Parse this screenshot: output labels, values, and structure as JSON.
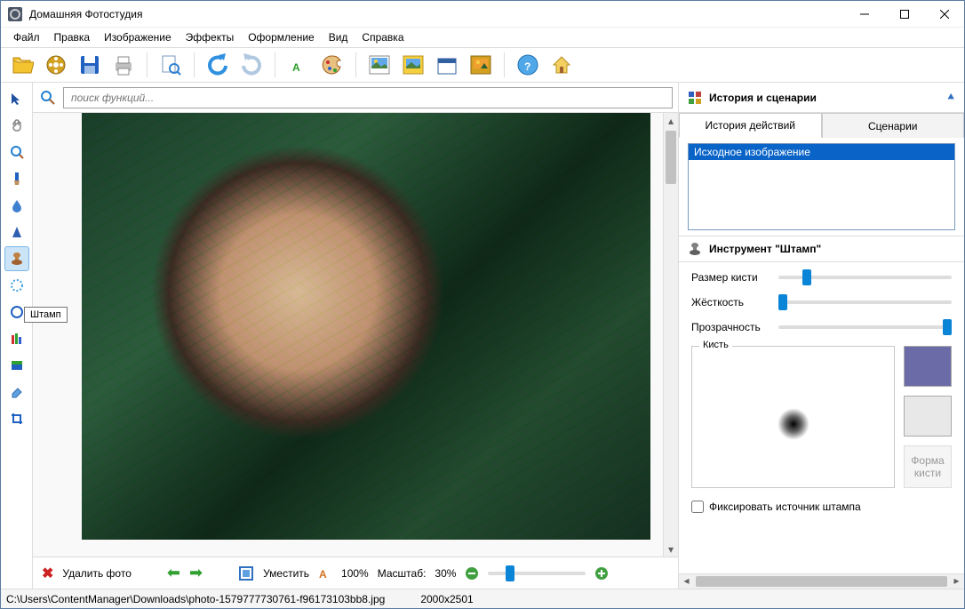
{
  "app": {
    "title": "Домашняя Фотостудия"
  },
  "menu": [
    "Файл",
    "Правка",
    "Изображение",
    "Эффекты",
    "Оформление",
    "Вид",
    "Справка"
  ],
  "search": {
    "placeholder": "поиск функций..."
  },
  "left_tools": [
    "pointer",
    "hand",
    "zoom",
    "brush",
    "blur",
    "sharpen",
    "stamp",
    "lighten",
    "darken",
    "redeye",
    "levels",
    "crop2",
    "eraser",
    "crop"
  ],
  "tooltip": "Штамп",
  "right": {
    "history_title": "История и сценарии",
    "tabs": [
      "История действий",
      "Сценарии"
    ],
    "history_item": "Исходное изображение",
    "tool_title": "Инструмент \"Штамп\"",
    "props": {
      "size": "Размер кисти",
      "hardness": "Жёсткость",
      "opacity": "Прозрачность"
    },
    "brush_tab": "Кисть",
    "shape_btn": "Форма кисти",
    "fix_source": "Фиксировать источник штампа"
  },
  "bottom": {
    "delete": "Удалить фото",
    "fit": "Уместить",
    "hundred": "100%",
    "scale_label": "Масштаб:",
    "scale_value": "30%"
  },
  "status": {
    "path": "C:\\Users\\ContentManager\\Downloads\\photo-1579777730761-f96173103bb8.jpg",
    "dims": "2000x2501"
  }
}
